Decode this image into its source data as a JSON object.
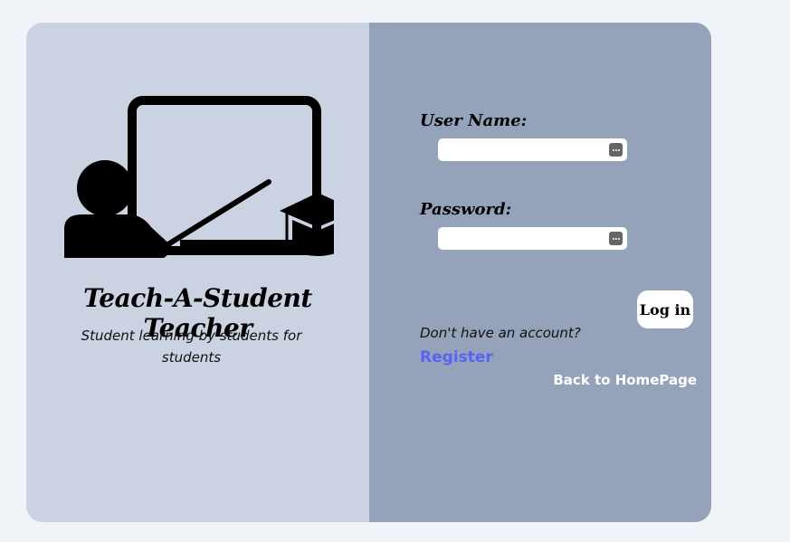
{
  "brand": {
    "title": "Teach-A-Student Teacher",
    "tagline": "Student learning by students for students",
    "illustration_icon": "teacher-at-board-icon"
  },
  "login_form": {
    "username_label": "User Name:",
    "username_value": "",
    "password_label": "Password:",
    "password_value": "",
    "field_icon": "password-manager-key-icon",
    "login_button_label": "Log in"
  },
  "footer_links": {
    "no_account_text": "Don't have an account?",
    "register_label": "Register",
    "back_home_label": "Back to HomePage"
  },
  "colors": {
    "page_background": "#f0f3f8",
    "left_panel": "#cbd2e2",
    "right_panel": "#94a2ba",
    "register_link": "#5b63f2",
    "homepage_link": "#ffffff"
  }
}
